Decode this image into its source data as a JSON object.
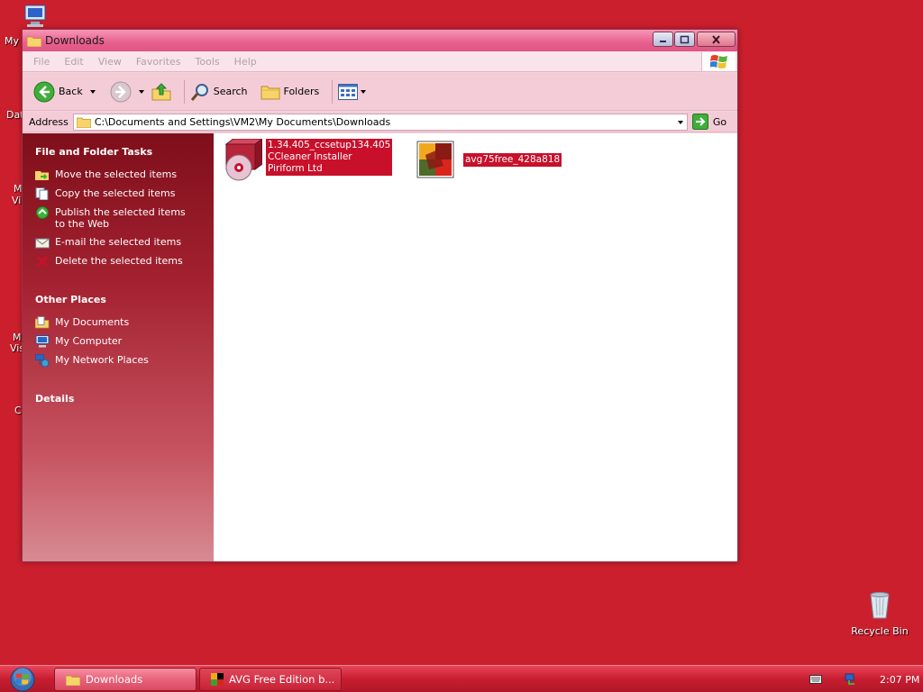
{
  "desktop": {
    "partial_labels": [
      "My",
      "Dat",
      "M",
      "Vi",
      "M",
      "Vis",
      "C"
    ],
    "recycle_bin": "Recycle Bin"
  },
  "window": {
    "title": "Downloads",
    "menus": [
      "File",
      "Edit",
      "View",
      "Favorites",
      "Tools",
      "Help"
    ],
    "toolbar": {
      "back": "Back",
      "search": "Search",
      "folders": "Folders"
    },
    "address": {
      "label": "Address",
      "value": "C:\\Documents and Settings\\VM2\\My Documents\\Downloads",
      "go": "Go"
    },
    "sidebar": {
      "tasks_title": "File and Folder Tasks",
      "tasks": [
        {
          "icon": "move-icon",
          "label": "Move the selected items"
        },
        {
          "icon": "copy-icon",
          "label": "Copy the selected items"
        },
        {
          "icon": "publish-icon",
          "label": "Publish the selected items\nto the Web"
        },
        {
          "icon": "email-icon",
          "label": "E-mail the selected items"
        },
        {
          "icon": "delete-icon",
          "label": "Delete the selected items"
        }
      ],
      "places_title": "Other Places",
      "places": [
        {
          "icon": "my-documents-icon",
          "label": "My Documents"
        },
        {
          "icon": "my-computer-icon",
          "label": "My Computer"
        },
        {
          "icon": "network-places-icon",
          "label": "My Network Places"
        }
      ],
      "details_title": "Details"
    },
    "files": [
      {
        "icon": "ccleaner-installer-icon",
        "lines": [
          "1.34.405_ccsetup134.405",
          "CCleaner Installer",
          "Piriform Ltd"
        ]
      },
      {
        "icon": "avg-installer-icon",
        "lines": [
          "avg75free_428a818"
        ]
      }
    ]
  },
  "taskbar": {
    "buttons": [
      "Downloads",
      "AVG Free Edition b..."
    ],
    "clock": "2:07 PM"
  },
  "colors": {
    "desktop": "#cc1f2d",
    "selection": "#c8102b",
    "sidebar_top": "#7e0f1a"
  }
}
